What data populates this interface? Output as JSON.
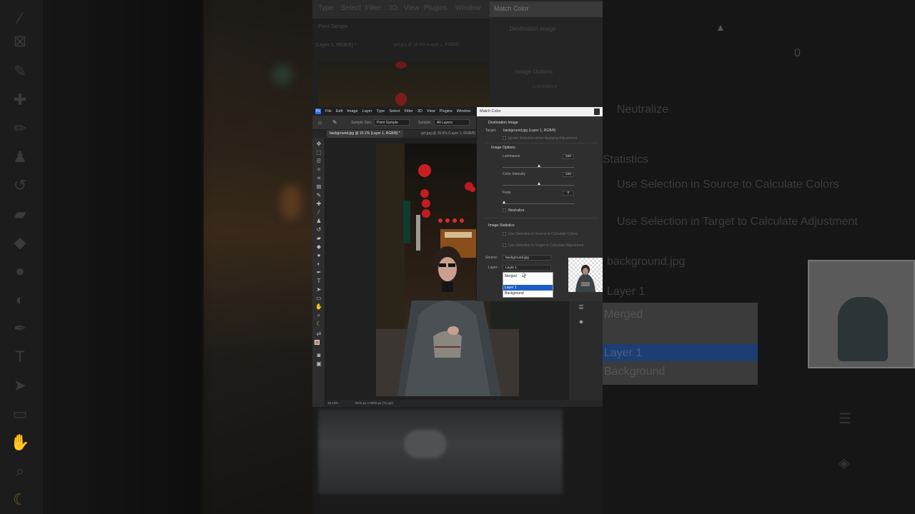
{
  "menu": {
    "items": [
      "File",
      "Edit",
      "Image",
      "Layer",
      "Type",
      "Select",
      "Filter",
      "3D",
      "View",
      "Plugins",
      "Window"
    ]
  },
  "options_bar": {
    "sample_size_label": "Sample Size:",
    "sample_size_value": "Point Sample",
    "sample_label": "Sample:",
    "sample_value": "All Layers"
  },
  "tabs": [
    {
      "label": "background.jpg @ 15.1% (Layer 1, RGB/8) *",
      "active": true
    },
    {
      "label": "girl.jpg @ 16.6% (Layer 1, RGB/8)",
      "active": false
    }
  ],
  "status": {
    "zoom": "15.13%",
    "doc_info": "3376 px x 6000 px (72 ppi)"
  },
  "dialog": {
    "title": "Match Color",
    "destination_heading": "Destination Image",
    "target_label": "Target:",
    "target_value": "background.jpg (Layer 1, RGB/8)",
    "ignore_selection": "Ignore Selection when Applying Adjustment",
    "image_options_heading": "Image Options",
    "luminance_label": "Luminance",
    "luminance_value": "100",
    "color_intensity_label": "Color Intensity",
    "color_intensity_value": "100",
    "fade_label": "Fade",
    "fade_value": "0",
    "neutralize_label": "Neutralize",
    "image_statistics_heading": "Image Statistics",
    "use_sel_source": "Use Selection in Source to Calculate Colors",
    "use_sel_target": "Use Selection in Target to Calculate Adjustment",
    "source_label": "Source:",
    "source_value": "background.jpg",
    "layer_label": "Layer:",
    "layer_value": "Layer 1",
    "dropdown_options": [
      "Merged",
      "Layer 1",
      "Background"
    ],
    "dropdown_highlighted": "Layer 1"
  },
  "bg_right": {
    "neutralize": "Neutralize",
    "statistics": "Statistics",
    "use_sel_source": "Use Selection in Source to Calculate Colors",
    "use_sel_target": "Use Selection in Target to Calculate Adjustment",
    "source_value": "background.jpg",
    "layer_value": "Layer 1",
    "options": [
      "Merged",
      "Layer 1",
      "Background"
    ],
    "fade_value": "0",
    "luminance_value": "100"
  },
  "bg_top": {
    "menu": [
      "Type",
      "Select",
      "Filter",
      "3D",
      "View",
      "Plugins",
      "Window"
    ],
    "dialog_title": "Match Color",
    "destination": "Destination Image",
    "image_options": "Image Options",
    "luminance": "Luminance",
    "sample": "Point Sample",
    "tab1": "(Layer 1, RGB/8) *",
    "tab2": "girl.jpg @ 16.6% (Layer 1, RGB/8)"
  },
  "colors": {
    "accent": "#1d5ec4",
    "ps_bg": "#262626",
    "dialog_bg": "#2f2f2f"
  }
}
